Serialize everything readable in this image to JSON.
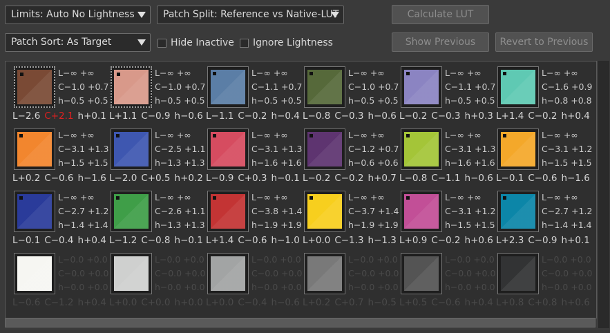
{
  "toolbar": {
    "limits_label": "Limits: Auto No Lightness",
    "patch_split_label": "Patch Split: Reference vs Native-LUT",
    "patch_sort_label": "Patch Sort: As Target",
    "hide_inactive_label": "Hide Inactive",
    "ignore_lightness_label": "Ignore Lightness",
    "calculate_lut_label": "Calculate LUT",
    "show_previous_label": "Show Previous",
    "revert_previous_label": "Revert to Previous"
  },
  "patches": [
    {
      "color": "#7a4a35",
      "selected": true,
      "marked": true,
      "dim": false,
      "l": "L−∞  +∞",
      "c": "C−1.0 +0.7",
      "h": "h−0.5 +0.5",
      "bL": "L−2.6",
      "bC": "C+2.1",
      "bH": "h+0.1",
      "redC": true
    },
    {
      "color": "#d8998a",
      "selected": true,
      "marked": true,
      "dim": false,
      "l": "L−∞  +∞",
      "c": "C−1.0 +0.7",
      "h": "h−0.5 +0.5",
      "bL": "L+1.1",
      "bC": "C−0.9",
      "bH": "h−0.6"
    },
    {
      "color": "#5b7ea6",
      "selected": false,
      "marked": true,
      "dim": false,
      "l": "L−∞  +∞",
      "c": "C−1.1 +0.7",
      "h": "h−0.5 +0.5",
      "bL": "L−1.1",
      "bC": "C−0.2",
      "bH": "h−0.4"
    },
    {
      "color": "#56693a",
      "selected": false,
      "marked": true,
      "dim": false,
      "l": "L−∞  +∞",
      "c": "C−1.0 +0.7",
      "h": "h−0.5 +0.5",
      "bL": "L−0.8",
      "bC": "C−0.3",
      "bH": "h−0.6"
    },
    {
      "color": "#8b84c2",
      "selected": false,
      "marked": true,
      "dim": false,
      "l": "L−∞  +∞",
      "c": "C−1.1 +0.7",
      "h": "h−0.5 +0.5",
      "bL": "L−0.2",
      "bC": "C−0.3",
      "bH": "h+0.3"
    },
    {
      "color": "#5fc9b3",
      "selected": false,
      "marked": true,
      "dim": false,
      "l": "L−∞  +∞",
      "c": "C−1.6 +0.9",
      "h": "h−0.8 +0.8",
      "bL": "L+1.4",
      "bC": "C−0.2",
      "bH": "h+0.4"
    },
    {
      "color": "#f2862e",
      "selected": false,
      "marked": true,
      "dim": false,
      "l": "L−∞  +∞",
      "c": "C−3.1 +1.3",
      "h": "h−1.5 +1.5",
      "bL": "L+0.2",
      "bC": "C−0.6",
      "bH": "h−1.6"
    },
    {
      "color": "#3e57b0",
      "selected": false,
      "marked": true,
      "dim": false,
      "l": "L−∞  +∞",
      "c": "C−2.5 +1.1",
      "h": "h−1.3 +1.3",
      "bL": "L−2.0",
      "bC": "C+0.5",
      "bH": "h+0.2"
    },
    {
      "color": "#d64c60",
      "selected": false,
      "marked": true,
      "dim": false,
      "l": "L−∞  +∞",
      "c": "C−3.1 +1.3",
      "h": "h−1.6 +1.6",
      "bL": "L−0.9",
      "bC": "C+0.3",
      "bH": "h−0.1"
    },
    {
      "color": "#5e3470",
      "selected": false,
      "marked": true,
      "dim": false,
      "l": "L−∞  +∞",
      "c": "C−1.2 +0.7",
      "h": "h−0.6 +0.6",
      "bL": "L−0.2",
      "bC": "C−0.2",
      "bH": "h+0.7"
    },
    {
      "color": "#a4c538",
      "selected": false,
      "marked": true,
      "dim": false,
      "l": "L−∞  +∞",
      "c": "C−3.1 +1.3",
      "h": "h−1.6 +1.6",
      "bL": "L−0.8",
      "bC": "C−1.1",
      "bH": "h−0.6"
    },
    {
      "color": "#f4a82a",
      "selected": false,
      "marked": true,
      "dim": false,
      "l": "L−∞  +∞",
      "c": "C−3.1 +1.2",
      "h": "h−1.5 +1.5",
      "bL": "L−0.1",
      "bC": "C−0.6",
      "bH": "h−1.6"
    },
    {
      "color": "#2a3b9a",
      "selected": false,
      "marked": true,
      "dim": false,
      "l": "L−∞  +∞",
      "c": "C−2.7 +1.2",
      "h": "h−1.4 +1.4",
      "bL": "L−0.1",
      "bC": "C−0.4",
      "bH": "h+0.4"
    },
    {
      "color": "#3f9e48",
      "selected": false,
      "marked": true,
      "dim": false,
      "l": "L−∞  +∞",
      "c": "C−2.6 +1.1",
      "h": "h−1.3 +1.3",
      "bL": "L−1.2",
      "bC": "C−0.8",
      "bH": "h−0.1"
    },
    {
      "color": "#c33434",
      "selected": false,
      "marked": true,
      "dim": false,
      "l": "L−∞  +∞",
      "c": "C−3.8 +1.4",
      "h": "h−1.9 +1.9",
      "bL": "L+1.4",
      "bC": "C−0.6",
      "bH": "h−1.0"
    },
    {
      "color": "#f7cf1e",
      "selected": false,
      "marked": true,
      "dim": false,
      "l": "L−∞  +∞",
      "c": "C−3.7 +1.4",
      "h": "h−1.9 +1.9",
      "bL": "L+0.0",
      "bC": "C−1.3",
      "bH": "h−1.3"
    },
    {
      "color": "#c24f97",
      "selected": false,
      "marked": true,
      "dim": false,
      "l": "L−∞  +∞",
      "c": "C−3.1 +1.2",
      "h": "h−1.5 +1.5",
      "bL": "L+0.9",
      "bC": "C−0.2",
      "bH": "h+0.6"
    },
    {
      "color": "#0c86a8",
      "selected": false,
      "marked": true,
      "dim": false,
      "l": "L−∞  +∞",
      "c": "C−2.7 +1.2",
      "h": "h−1.4 +1.4",
      "bL": "L+2.3",
      "bC": "C−0.9",
      "bH": "h+0.1"
    },
    {
      "color": "#f6f6f2",
      "selected": false,
      "marked": false,
      "dim": true,
      "l": "L−0.0 +0.0",
      "c": "C−0.0 +0.0",
      "h": "h−0.0 +0.0",
      "bL": "L−0.6",
      "bC": "C−1.2",
      "bH": "h+0.4"
    },
    {
      "color": "#cfd0cf",
      "selected": false,
      "marked": false,
      "dim": true,
      "l": "L−0.0 +0.0",
      "c": "C−0.0 +0.0",
      "h": "h−0.0 +0.0",
      "bL": "L+0.0",
      "bC": "C+0.0",
      "bH": "h+0.0"
    },
    {
      "color": "#a2a4a4",
      "selected": false,
      "marked": false,
      "dim": true,
      "l": "L−0.0 +0.0",
      "c": "C−0.0 +0.0",
      "h": "h−0.0 +0.0",
      "bL": "L+0.0",
      "bC": "C−0.4",
      "bH": "h−0.6"
    },
    {
      "color": "#797979",
      "selected": false,
      "marked": false,
      "dim": true,
      "l": "L−0.0 +0.0",
      "c": "C−0.0 +0.0",
      "h": "h−0.0 +0.0",
      "bL": "L+0.2",
      "bC": "C+0.7",
      "bH": "h−0.5"
    },
    {
      "color": "#545454",
      "selected": false,
      "marked": false,
      "dim": true,
      "l": "L−0.0 +0.0",
      "c": "C−0.0 +0.0",
      "h": "h−0.0 +0.0",
      "bL": "L+0.5",
      "bC": "C−0.6",
      "bH": "h+0.4"
    },
    {
      "color": "#323334",
      "selected": false,
      "marked": false,
      "dim": true,
      "l": "L−0.0 +0.0",
      "c": "C−0.0 +0.0",
      "h": "h−0.0 +0.0",
      "bL": "L+0.8",
      "bC": "C+0.8",
      "bH": "h+0.6"
    }
  ]
}
